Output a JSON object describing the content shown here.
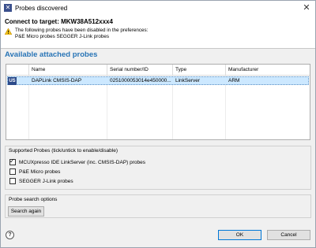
{
  "window": {
    "title": "Probes discovered",
    "app_icon": "eclipse-x-icon"
  },
  "header": {
    "connect_title": "Connect to target: MKW38A512xxx4",
    "warning_line1": "The following probes have been disabled in the preferences:",
    "warning_line2": "P&E Micro probes SEGGER J-Link probes"
  },
  "section_title": "Available attached probes",
  "table": {
    "columns": [
      "Name",
      "Serial number/ID",
      "Type",
      "Manufacturer"
    ],
    "rows": [
      {
        "icon_text": "US",
        "name": "DAPLink CMSIS-DAP",
        "serial": "0251000053014e450000...",
        "type": "LinkServer",
        "manufacturer": "ARM"
      }
    ]
  },
  "supported": {
    "label": "Supported Probes (tick/untick to enable/disable)",
    "items": [
      {
        "label": "MCUXpresso IDE LinkServer (inc. CMSIS-DAP) probes",
        "checked": true
      },
      {
        "label": "P&E Micro probes",
        "checked": false
      },
      {
        "label": "SEGGER J-Link probes",
        "checked": false
      }
    ]
  },
  "search": {
    "label": "Probe search options",
    "button": "Search again"
  },
  "footer": {
    "help": "?",
    "ok": "OK",
    "cancel": "Cancel"
  },
  "colors": {
    "accent": "#2874b6",
    "selection": "#cce8ff"
  }
}
